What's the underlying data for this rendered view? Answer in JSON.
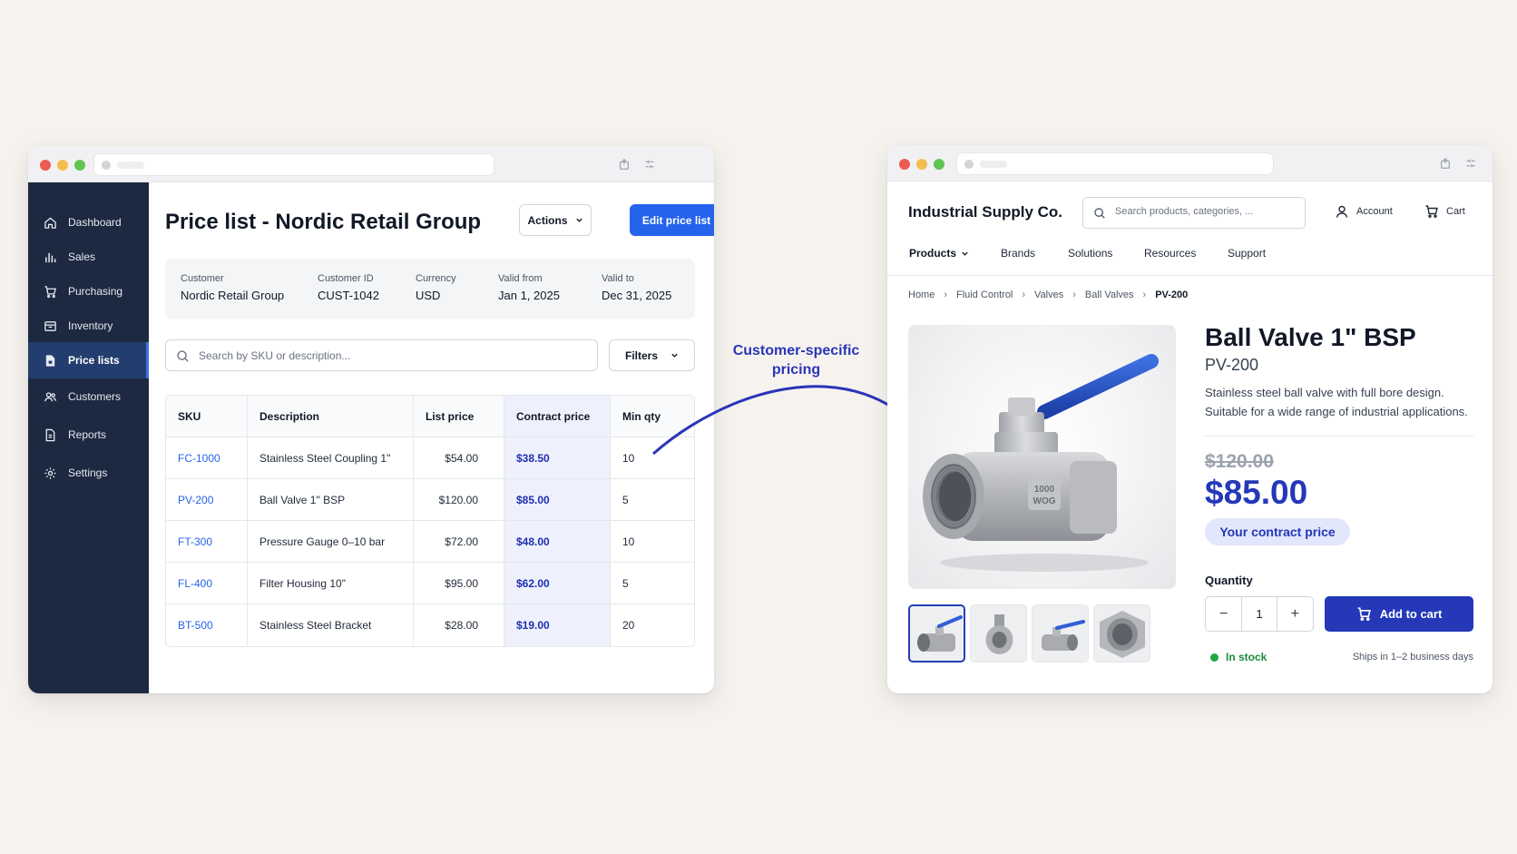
{
  "admin": {
    "sidebar": {
      "items": [
        {
          "label": "Dashboard",
          "icon": "home-icon"
        },
        {
          "label": "Sales",
          "icon": "bar-chart-icon"
        },
        {
          "label": "Purchasing",
          "icon": "cart-icon"
        },
        {
          "label": "Inventory",
          "icon": "box-icon"
        },
        {
          "label": "Price lists",
          "icon": "document-tag-icon",
          "active": true
        },
        {
          "label": "Customers",
          "icon": "users-icon"
        },
        {
          "label": "Reports",
          "icon": "report-icon"
        },
        {
          "label": "Settings",
          "icon": "gear-icon"
        }
      ]
    },
    "title": "Price list - Nordic Retail Group",
    "actions_label": "Actions",
    "edit_label": "Edit price list",
    "info": {
      "customer_label": "Customer",
      "customer": "Nordic Retail Group",
      "customer_id_label": "Customer ID",
      "customer_id": "CUST-1042",
      "currency_label": "Currency",
      "currency": "USD",
      "valid_from_label": "Valid from",
      "valid_from": "Jan 1, 2025",
      "valid_to_label": "Valid to",
      "valid_to": "Dec 31, 2025"
    },
    "search_placeholder": "Search by SKU or description...",
    "filters_label": "Filters",
    "table": {
      "headers": [
        "SKU",
        "Description",
        "List price",
        "Contract price",
        "Min qty"
      ],
      "rows": [
        [
          "FC-1000",
          "Stainless Steel Coupling 1\"",
          "$54.00",
          "$38.50",
          "10"
        ],
        [
          "PV-200",
          "Ball Valve 1\" BSP",
          "$120.00",
          "$85.00",
          "5"
        ],
        [
          "FT-300",
          "Pressure Gauge 0–10 bar",
          "$72.00",
          "$48.00",
          "10"
        ],
        [
          "FL-400",
          "Filter Housing 10\"",
          "$95.00",
          "$62.00",
          "5"
        ],
        [
          "BT-500",
          "Stainless Steel Bracket",
          "$28.00",
          "$19.00",
          "20"
        ]
      ]
    }
  },
  "annotation": {
    "line1": "Customer-specific",
    "line2": "pricing"
  },
  "store": {
    "brand": "Industrial Supply Co.",
    "search_placeholder": "Search products, categories, ...",
    "account_label": "Account",
    "cart_label": "Cart",
    "nav": [
      "Products",
      "Brands",
      "Solutions",
      "Resources",
      "Support"
    ],
    "breadcrumbs": [
      "Home",
      "Fluid Control",
      "Valves",
      "Ball Valves",
      "PV-200"
    ],
    "product": {
      "title": "Ball Valve 1\" BSP",
      "sku": "PV-200",
      "description": "Stainless steel ball valve with full bore design. Suitable for a wide range of industrial applications.",
      "old_price": "$120.00",
      "price": "$85.00",
      "badge": "Your contract price",
      "quantity_label": "Quantity",
      "quantity": "1",
      "minus": "−",
      "plus": "+",
      "add_to_cart": "Add to cart",
      "stock": "In stock",
      "shipping": "Ships in 1–2 business days",
      "valve_marking_1": "1000",
      "valve_marking_2": "WOG"
    }
  },
  "colors": {
    "accent": "#2563eb",
    "contract": "#2438b8",
    "sidebar": "#1c2940",
    "stock": "#1a8a3a"
  }
}
